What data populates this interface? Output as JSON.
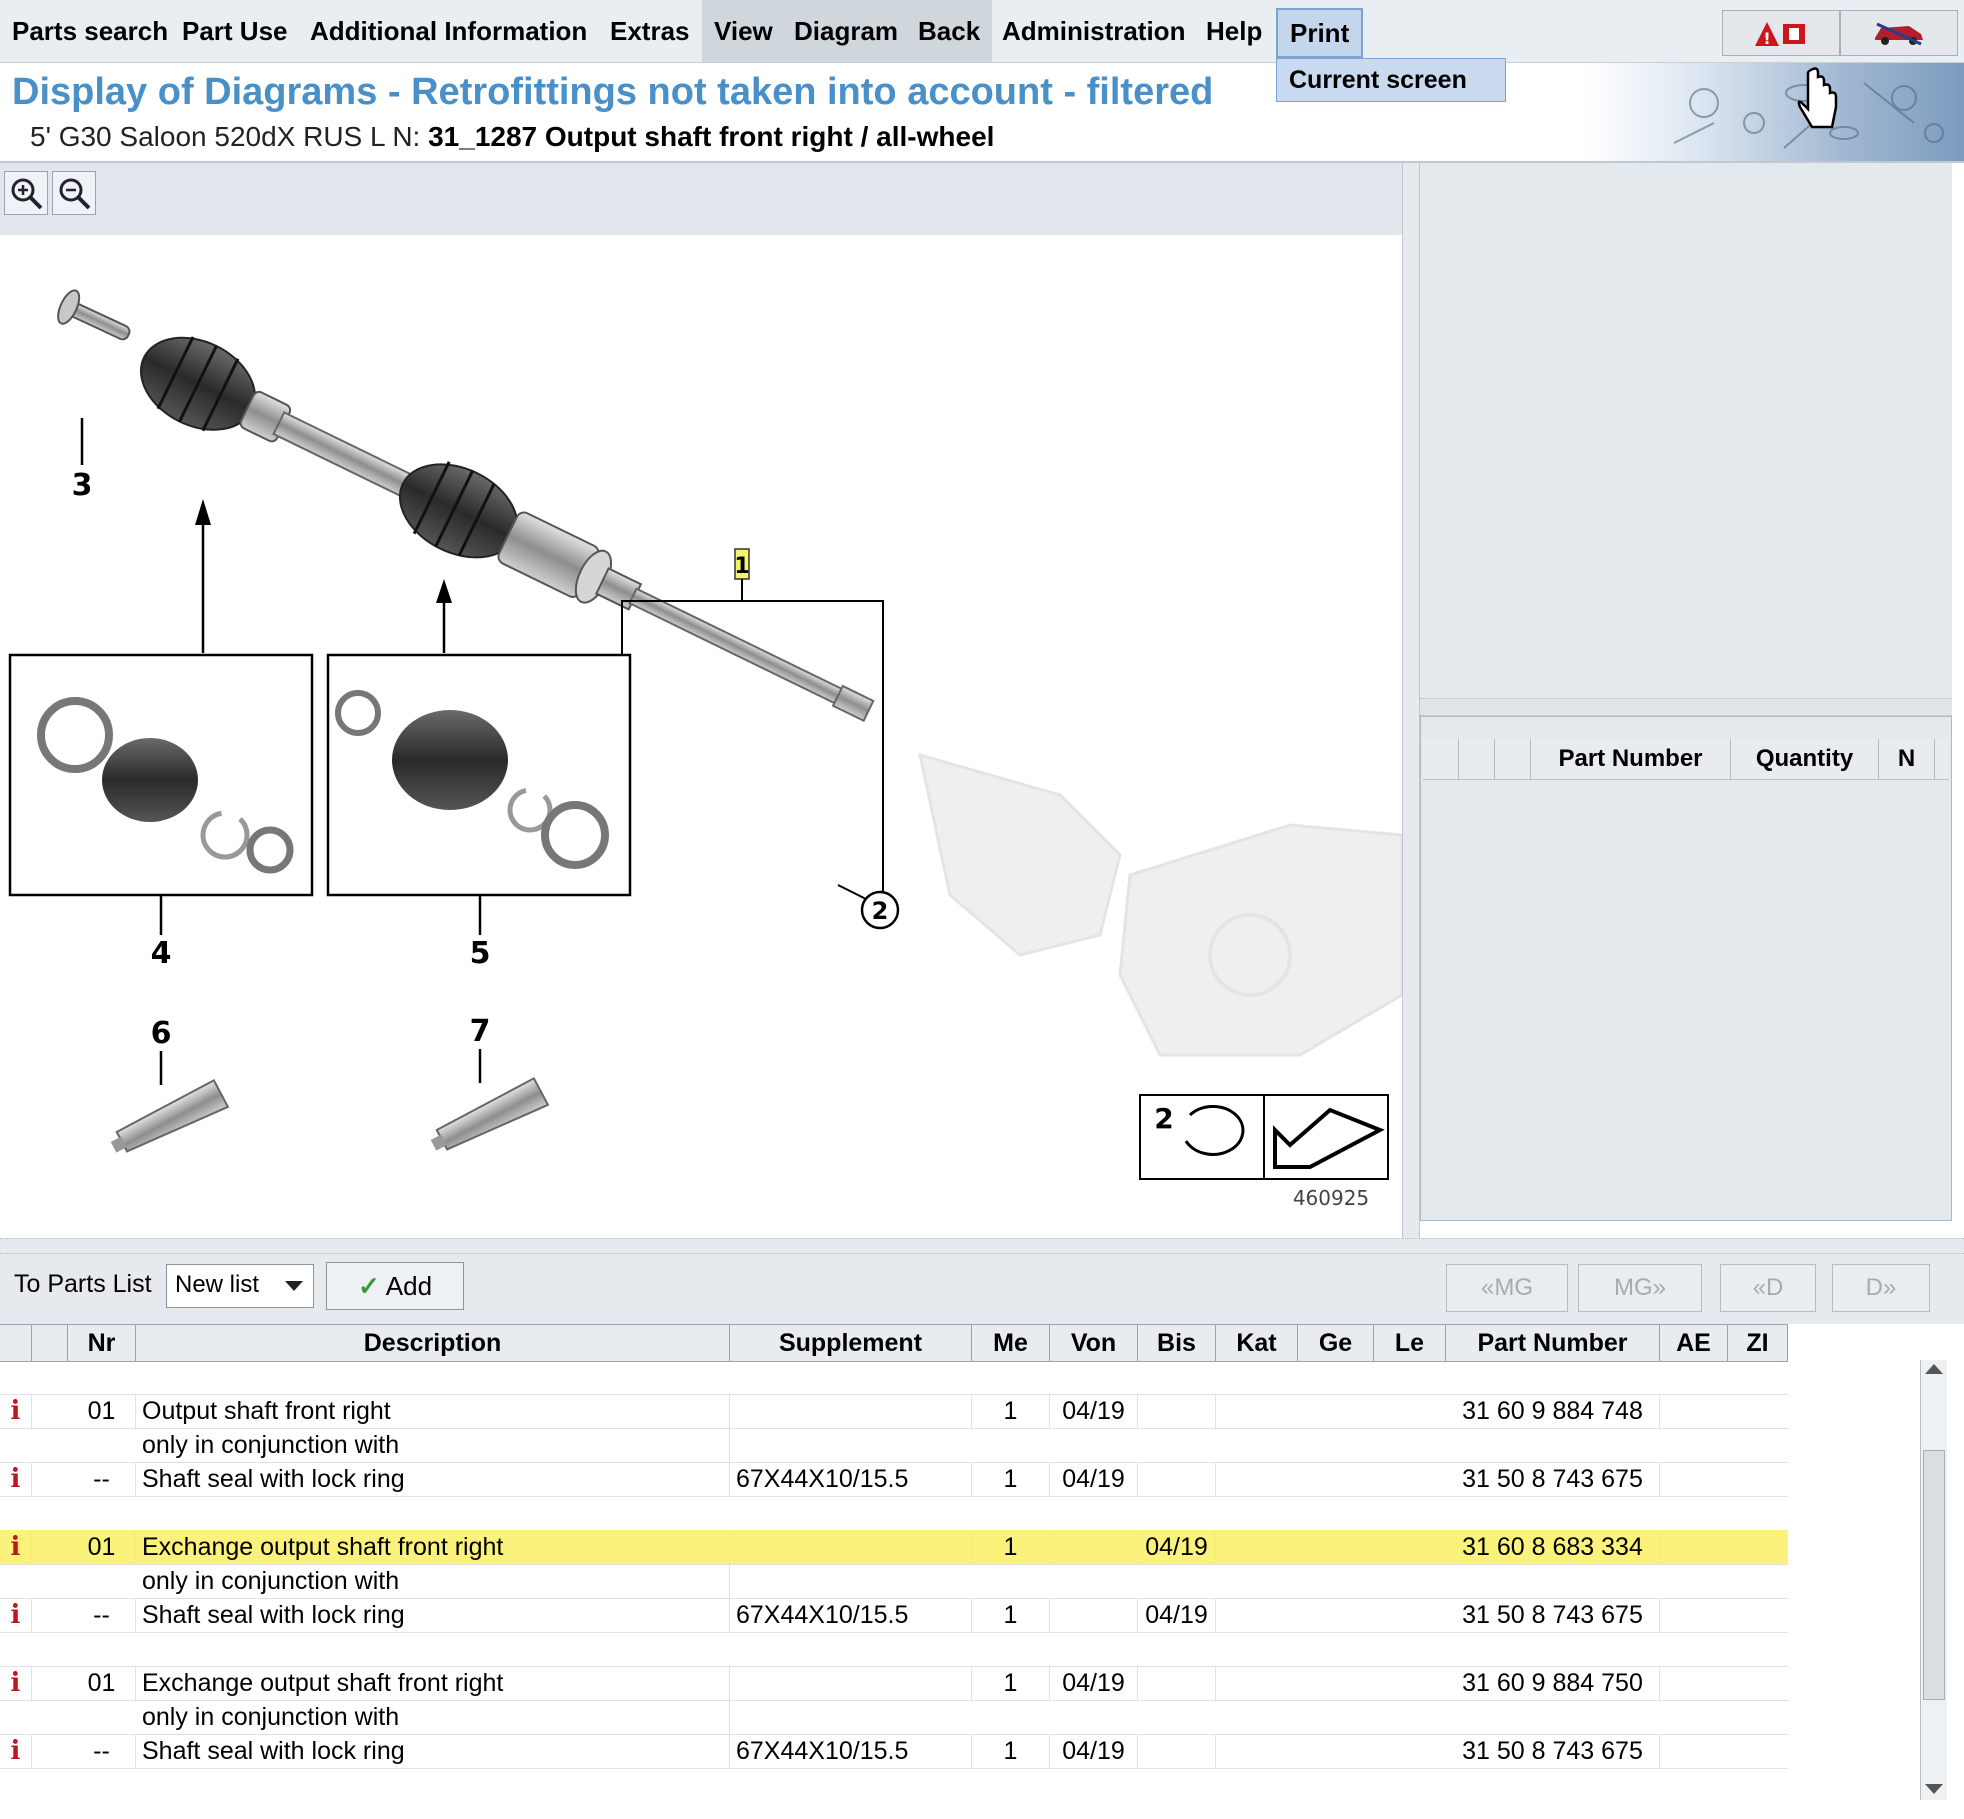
{
  "menu": {
    "items": [
      "Parts search",
      "Part Use",
      "Additional Information",
      "Extras",
      "View",
      "Diagram",
      "Back",
      "Administration",
      "Help",
      "Print"
    ],
    "dropdown_item": "Current screen"
  },
  "header": {
    "title": "Display of Diagrams - Retrofittings not taken into account - filtered",
    "vehicle": "5' G30 Saloon 520dX RUS",
    "ln_label": "L N:",
    "ln_value": "31_1287 Output shaft front right / all-wheel"
  },
  "diagram": {
    "callouts": [
      "1",
      "2",
      "3",
      "4",
      "5",
      "6",
      "7"
    ],
    "legend_number": "2",
    "image_number": "460925"
  },
  "right_panel": {
    "columns": [
      "Part Number",
      "Quantity",
      "N"
    ]
  },
  "toolbar": {
    "to_parts_list_label": "To Parts List",
    "list_select_value": "New list",
    "add_label": "Add",
    "nav": [
      "«MG",
      "MG»",
      "«D",
      "D»"
    ]
  },
  "table": {
    "columns": [
      "Nr",
      "Description",
      "Supplement",
      "Me",
      "Von",
      "Bis",
      "Kat",
      "Ge",
      "Le",
      "Part Number",
      "AE",
      "ZI"
    ],
    "rows": [
      {
        "info": "i",
        "nr": "01",
        "description": "Output shaft front right",
        "supplement": "",
        "me": "1",
        "von": "04/19",
        "bis": "",
        "part_number": "31 60 9 884 748"
      },
      {
        "info": "",
        "nr": "",
        "description": "only in conjunction with",
        "supplement": "",
        "me": "",
        "von": "",
        "bis": "",
        "part_number": ""
      },
      {
        "info": "i",
        "nr": "--",
        "description": "Shaft seal with lock ring",
        "supplement": "67X44X10/15.5",
        "me": "1",
        "von": "04/19",
        "bis": "",
        "part_number": "31 50 8 743 675"
      },
      {
        "info": "",
        "nr": "",
        "description": "",
        "supplement": "",
        "me": "",
        "von": "",
        "bis": "",
        "part_number": ""
      },
      {
        "info": "i",
        "nr": "01",
        "description": "Exchange output shaft front right",
        "supplement": "",
        "me": "1",
        "von": "",
        "bis": "04/19",
        "part_number": "31 60 8 683 334"
      },
      {
        "info": "",
        "nr": "",
        "description": "only in conjunction with",
        "supplement": "",
        "me": "",
        "von": "",
        "bis": "",
        "part_number": ""
      },
      {
        "info": "i",
        "nr": "--",
        "description": "Shaft seal with lock ring",
        "supplement": "67X44X10/15.5",
        "me": "1",
        "von": "",
        "bis": "04/19",
        "part_number": "31 50 8 743 675"
      },
      {
        "info": "",
        "nr": "",
        "description": "",
        "supplement": "",
        "me": "",
        "von": "",
        "bis": "",
        "part_number": ""
      },
      {
        "info": "i",
        "nr": "01",
        "description": "Exchange output shaft front right",
        "supplement": "",
        "me": "1",
        "von": "04/19",
        "bis": "",
        "part_number": "31 60 9 884 750"
      },
      {
        "info": "",
        "nr": "",
        "description": "only in conjunction with",
        "supplement": "",
        "me": "",
        "von": "",
        "bis": "",
        "part_number": ""
      },
      {
        "info": "i",
        "nr": "--",
        "description": "Shaft seal with lock ring",
        "supplement": "67X44X10/15.5",
        "me": "1",
        "von": "04/19",
        "bis": "",
        "part_number": "31 50 8 743 675"
      }
    ],
    "highlight_color": "#fbf27c"
  },
  "colors": {
    "title": "#4a90c8",
    "info_icon": "#c0161e",
    "check": "#3a9a3a"
  }
}
